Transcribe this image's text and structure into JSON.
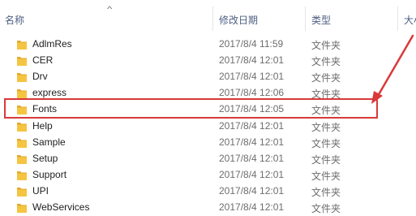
{
  "columns": {
    "name": "名称",
    "date": "修改日期",
    "type": "类型",
    "size": "大小"
  },
  "files": [
    {
      "name": "AdlmRes",
      "date": "2017/8/4 11:59",
      "type": "文件夹"
    },
    {
      "name": "CER",
      "date": "2017/8/4 12:01",
      "type": "文件夹"
    },
    {
      "name": "Drv",
      "date": "2017/8/4 12:01",
      "type": "文件夹"
    },
    {
      "name": "express",
      "date": "2017/8/4 12:06",
      "type": "文件夹"
    },
    {
      "name": "Fonts",
      "date": "2017/8/4 12:05",
      "type": "文件夹"
    },
    {
      "name": "Help",
      "date": "2017/8/4 12:01",
      "type": "文件夹"
    },
    {
      "name": "Sample",
      "date": "2017/8/4 12:01",
      "type": "文件夹"
    },
    {
      "name": "Setup",
      "date": "2017/8/4 12:01",
      "type": "文件夹"
    },
    {
      "name": "Support",
      "date": "2017/8/4 12:01",
      "type": "文件夹"
    },
    {
      "name": "UPI",
      "date": "2017/8/4 12:01",
      "type": "文件夹"
    },
    {
      "name": "WebServices",
      "date": "2017/8/4 12:01",
      "type": "文件夹"
    }
  ],
  "highlighted_file": "Fonts",
  "colors": {
    "annotation": "#d9393a",
    "folder": "#f5c542",
    "header_text": "#4d6082"
  },
  "icons": {
    "folder": "folder-icon",
    "sort": "sort-ascending-icon",
    "arrow": "annotation-arrow-icon"
  }
}
